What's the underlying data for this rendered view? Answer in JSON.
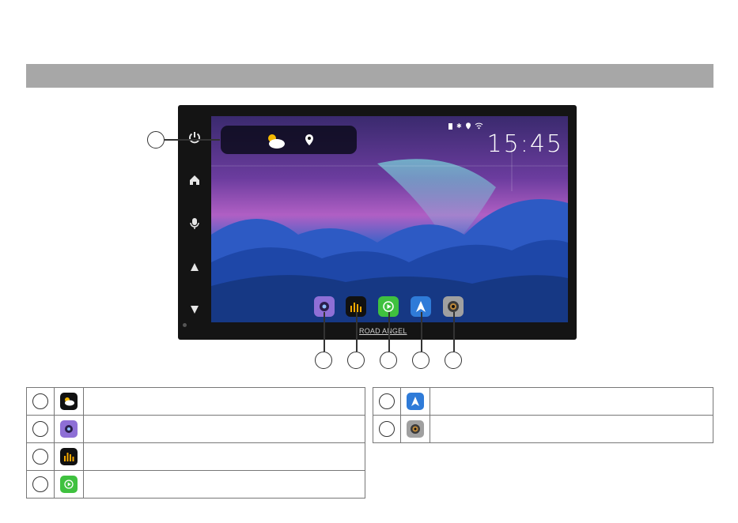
{
  "device": {
    "brand": "ROAD ANGEL",
    "clock": "15:45",
    "side_buttons": [
      "power-icon",
      "home-icon",
      "mic-icon",
      "volume-up-icon",
      "volume-down-icon"
    ],
    "status_icons": [
      "sd-card-icon",
      "bluetooth-icon",
      "location-icon",
      "wifi-icon"
    ],
    "dock": [
      {
        "name": "camera-app-icon",
        "color": "#8e6fd6"
      },
      {
        "name": "audio-eq-app-icon",
        "color": "#1a1a1a"
      },
      {
        "name": "carplay-app-icon",
        "color": "#3fc13f"
      },
      {
        "name": "android-auto-app-icon",
        "color": "#2f7bd8"
      },
      {
        "name": "dashcam-app-icon",
        "color": "#a0a0a0"
      }
    ]
  },
  "legend_left": [
    {
      "icon": "weather-app-icon",
      "color": "#111111"
    },
    {
      "icon": "camera-app-icon",
      "color": "#8e6fd6"
    },
    {
      "icon": "audio-eq-app-icon",
      "color": "#1a1a1a"
    },
    {
      "icon": "carplay-app-icon",
      "color": "#3fc13f"
    }
  ],
  "legend_right": [
    {
      "icon": "android-auto-app-icon",
      "color": "#2f7bd8"
    },
    {
      "icon": "dashcam-app-icon",
      "color": "#a0a0a0"
    }
  ],
  "colors": {
    "header_bar": "#a7a7a7",
    "device_bezel": "#141414"
  }
}
